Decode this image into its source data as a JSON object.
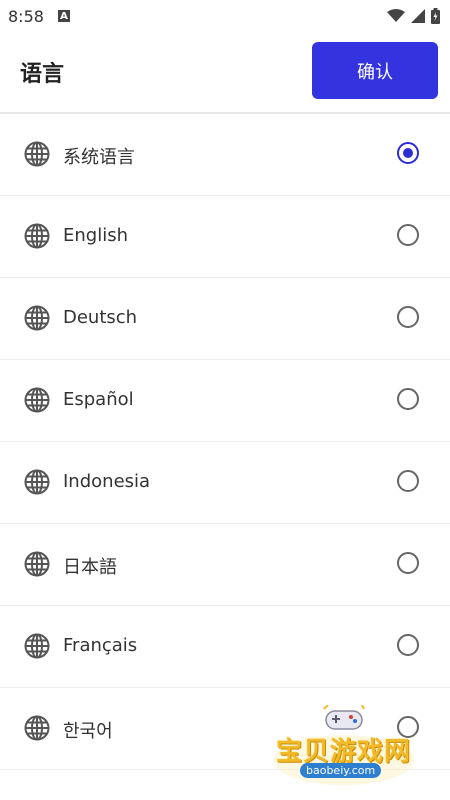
{
  "status_bar": {
    "time": "8:58",
    "notification_icon": "A"
  },
  "header": {
    "title": "语言",
    "confirm_label": "确认"
  },
  "languages": [
    {
      "label": "系统语言",
      "selected": true
    },
    {
      "label": "English",
      "selected": false
    },
    {
      "label": "Deutsch",
      "selected": false
    },
    {
      "label": "Español",
      "selected": false
    },
    {
      "label": "Indonesia",
      "selected": false
    },
    {
      "label": "日本語",
      "selected": false
    },
    {
      "label": "Français",
      "selected": false
    },
    {
      "label": "한국어",
      "selected": false
    }
  ],
  "watermark": {
    "text": "宝贝游戏网",
    "url": "baobeiy.com"
  },
  "colors": {
    "accent": "#3333e0",
    "selected_radio": "#2d2dd4"
  },
  "icons": [
    "globe-icon",
    "wifi-icon",
    "signal-icon",
    "battery-icon"
  ]
}
